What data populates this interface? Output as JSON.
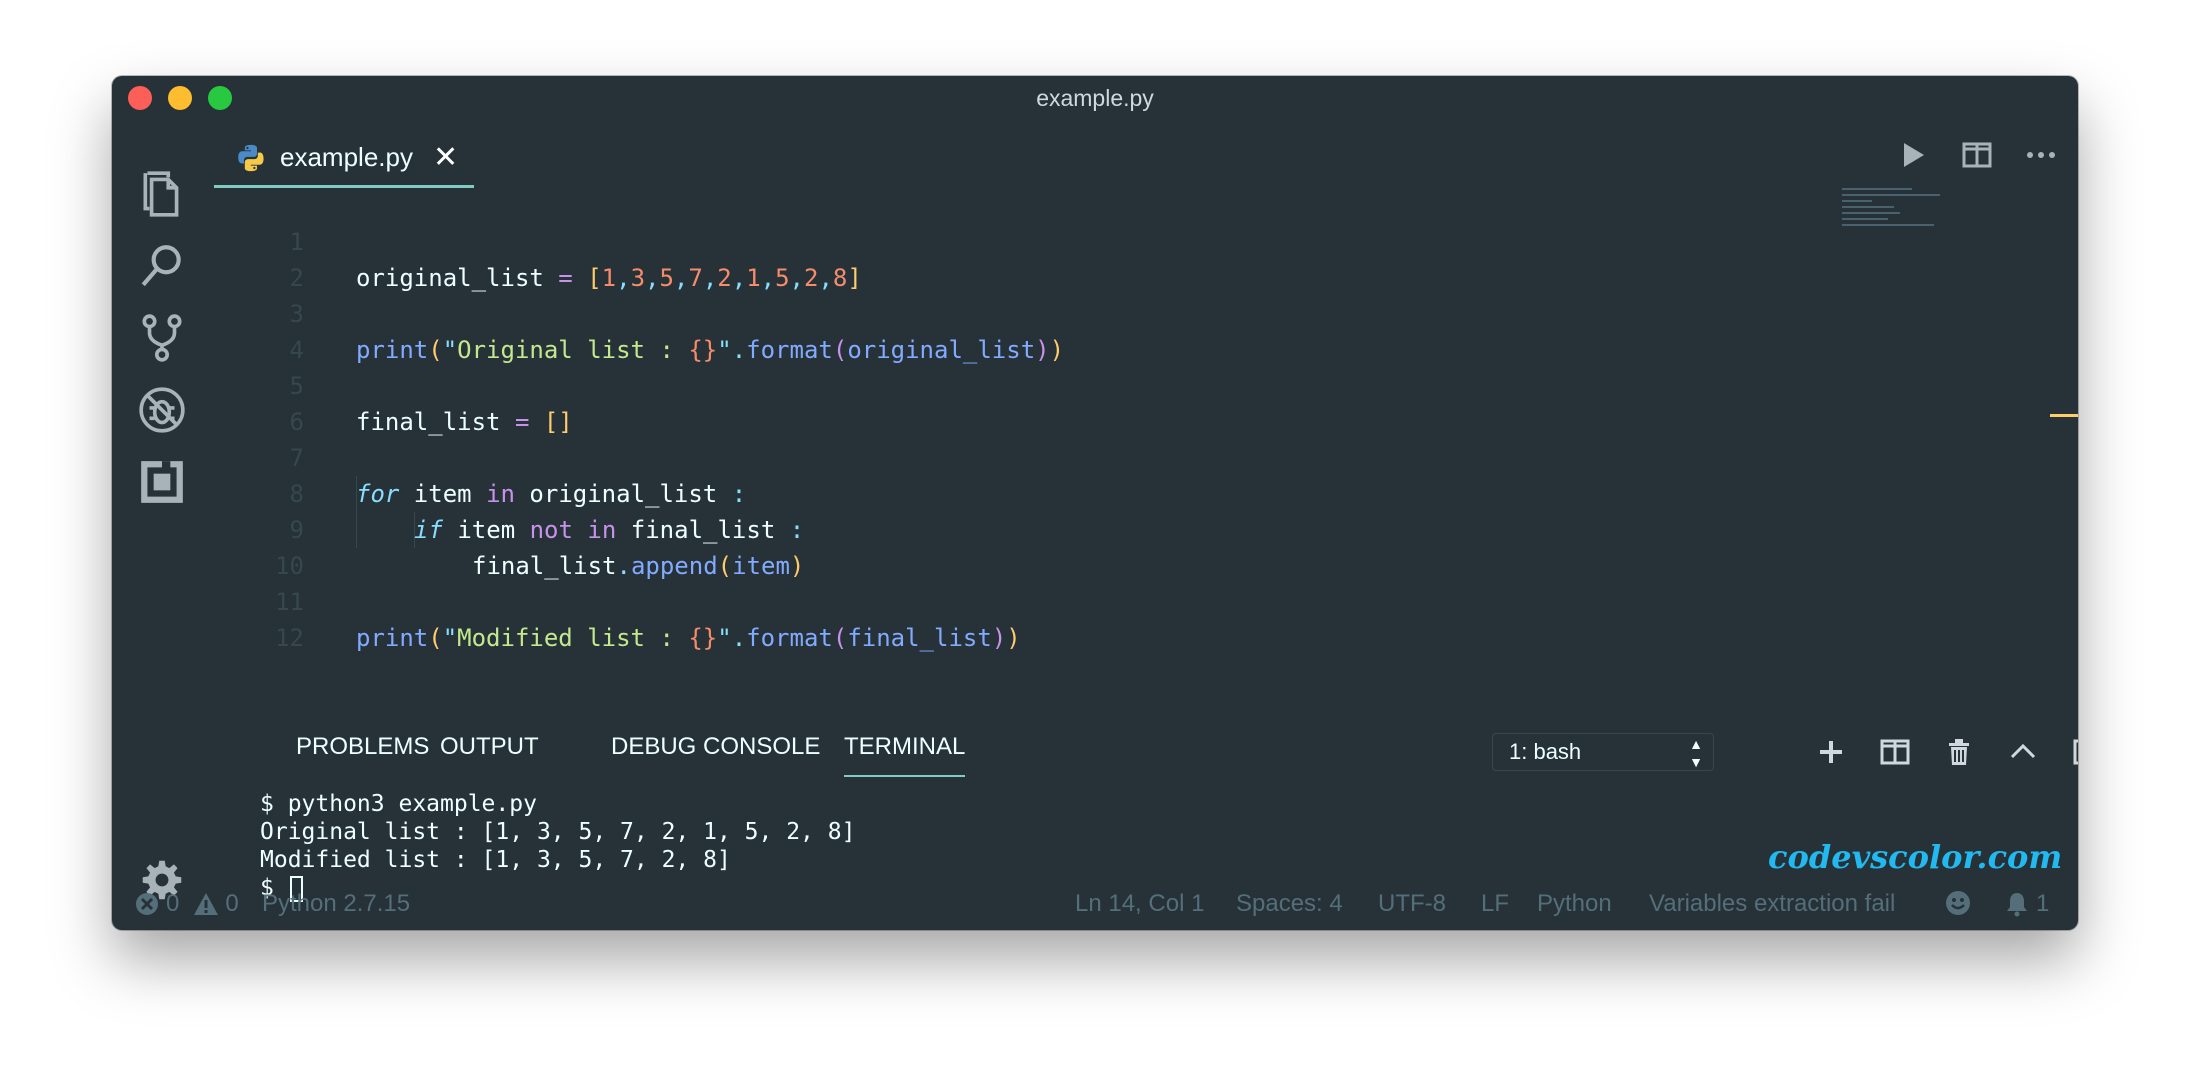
{
  "window": {
    "title": "example.py"
  },
  "tab": {
    "label": "example.py",
    "close_glyph": "✕"
  },
  "editor": {
    "lines": [
      {
        "n": "1"
      },
      {
        "n": "2"
      },
      {
        "n": "3"
      },
      {
        "n": "4"
      },
      {
        "n": "5"
      },
      {
        "n": "6"
      },
      {
        "n": "7"
      },
      {
        "n": "8"
      },
      {
        "n": "9"
      },
      {
        "n": "10"
      },
      {
        "n": "11"
      },
      {
        "n": "12"
      }
    ],
    "code": {
      "l1": {
        "var": "original_list",
        "op": " = ",
        "open": "[",
        "nums": [
          "1",
          "3",
          "5",
          "7",
          "2",
          "1",
          "5",
          "2",
          "8"
        ],
        "close": "]"
      },
      "l3": {
        "fn": "print",
        "open": "(",
        "q1": "\"",
        "str": "Original list : ",
        "fmt": "{}",
        "q2": "\"",
        "dot": ".",
        "method": "format",
        "open2": "(",
        "arg": "original_list",
        "close2": ")",
        "close": ")"
      },
      "l5": {
        "var": "final_list",
        "op": " = ",
        "list": "[]"
      },
      "l7": {
        "kw": "for",
        "var": " item ",
        "in": "in",
        "rest": " original_list ",
        "colon": ":"
      },
      "l8": {
        "kw": "if",
        "var": " item ",
        "not": "not",
        "in": " in",
        "rest": " final_list ",
        "colon": ":"
      },
      "l9": {
        "obj": "final_list",
        "dot": ".",
        "method": "append",
        "open": "(",
        "arg": "item",
        "close": ")"
      },
      "l11": {
        "fn": "print",
        "open": "(",
        "q1": "\"",
        "str": "Modified list : ",
        "fmt": "{}",
        "q2": "\"",
        "dot": ".",
        "method": "format",
        "open2": "(",
        "arg": "final_list",
        "close2": ")",
        "close": ")"
      }
    }
  },
  "panel": {
    "tabs": [
      "PROBLEMS",
      "OUTPUT",
      "DEBUG CONSOLE",
      "TERMINAL"
    ],
    "active_tab": "TERMINAL",
    "terminal_select": "1: bash",
    "terminal_lines": [
      "$ python3 example.py",
      "Original list : [1, 3, 5, 7, 2, 1, 5, 2, 8]",
      "Modified list : [1, 3, 5, 7, 2, 8]",
      "$ "
    ]
  },
  "watermark": "codevscolor.com",
  "statusbar": {
    "errors": "0",
    "warnings": "0",
    "interpreter": "Python 2.7.15",
    "position": "Ln 14, Col 1",
    "spaces": "Spaces: 4",
    "encoding": "UTF-8",
    "eol": "LF",
    "language": "Python",
    "message": "Variables extraction fail",
    "notifications": "1"
  },
  "icons": {
    "activity": [
      "files-icon",
      "search-icon",
      "source-control-icon",
      "debug-icon",
      "extensions-icon"
    ],
    "settings": "gear-icon"
  },
  "colors": {
    "background": "#263238",
    "accent": "#80cbc4",
    "string": "#c3e88d",
    "number": "#f78c6c",
    "keyword": "#c792ea",
    "function": "#82aaff",
    "operator": "#89ddff",
    "bracket": "#ffcb6b",
    "watermark": "#22b8f0"
  }
}
